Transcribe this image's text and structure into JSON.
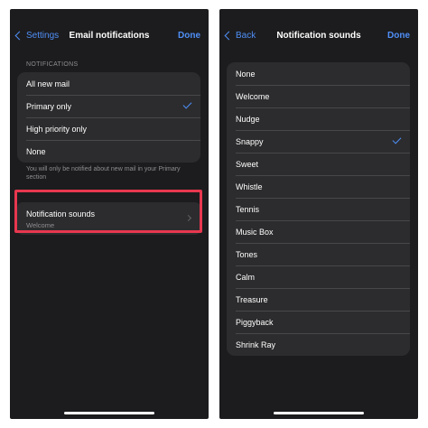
{
  "email_screen": {
    "nav": {
      "back_label": "Settings",
      "title": "Email notifications",
      "done_label": "Done"
    },
    "section_header": "NOTIFICATIONS",
    "options": [
      {
        "label": "All new mail",
        "selected": false
      },
      {
        "label": "Primary only",
        "selected": true
      },
      {
        "label": "High priority only",
        "selected": false
      },
      {
        "label": "None",
        "selected": false
      }
    ],
    "footer_note": "You will only be notified about new mail in your Primary section",
    "sounds_row": {
      "title": "Notification sounds",
      "value": "Welcome"
    },
    "highlight_color": "#e8374f"
  },
  "sounds_screen": {
    "nav": {
      "back_label": "Back",
      "title": "Notification sounds",
      "done_label": "Done"
    },
    "sounds": [
      {
        "label": "None",
        "selected": false
      },
      {
        "label": "Welcome",
        "selected": false
      },
      {
        "label": "Nudge",
        "selected": false
      },
      {
        "label": "Snappy",
        "selected": true
      },
      {
        "label": "Sweet",
        "selected": false
      },
      {
        "label": "Whistle",
        "selected": false
      },
      {
        "label": "Tennis",
        "selected": false
      },
      {
        "label": "Music Box",
        "selected": false
      },
      {
        "label": "Tones",
        "selected": false
      },
      {
        "label": "Calm",
        "selected": false
      },
      {
        "label": "Treasure",
        "selected": false
      },
      {
        "label": "Piggyback",
        "selected": false
      },
      {
        "label": "Shrink Ray",
        "selected": false
      }
    ]
  },
  "colors": {
    "background": "#1c1c1e",
    "group": "#2c2c2e",
    "accent": "#4f8ff7",
    "secondary_text": "#8e8e93"
  }
}
